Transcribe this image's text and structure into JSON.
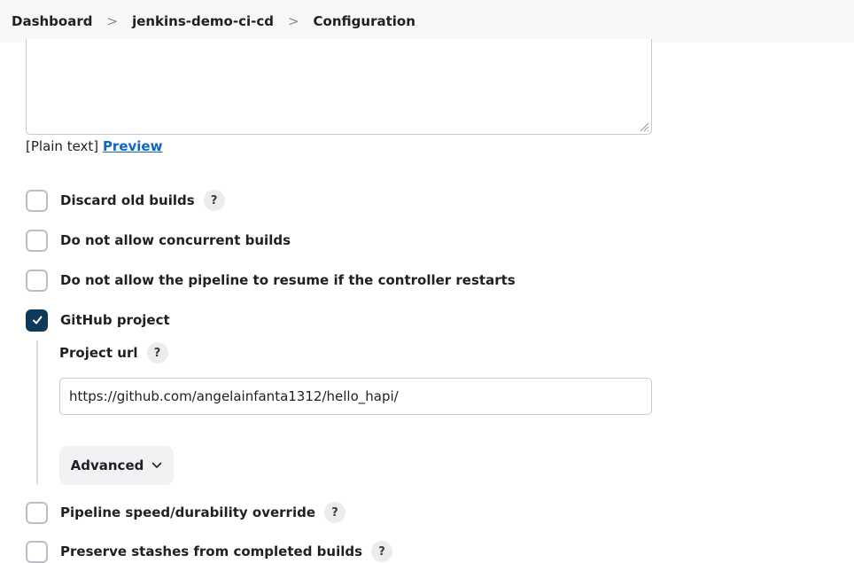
{
  "breadcrumb": {
    "items": [
      "Dashboard",
      "jenkins-demo-ci-cd",
      "Configuration"
    ],
    "separator": ">"
  },
  "description": {
    "format_text": "[Plain text]",
    "preview_link": "Preview"
  },
  "options": [
    {
      "label": "Discard old builds",
      "checked": false,
      "help": "?"
    },
    {
      "label": "Do not allow concurrent builds",
      "checked": false
    },
    {
      "label": "Do not allow the pipeline to resume if the controller restarts",
      "checked": false
    },
    {
      "label": "GitHub project",
      "checked": true
    },
    {
      "label": "Pipeline speed/durability override",
      "checked": false,
      "help": "?"
    },
    {
      "label": "Preserve stashes from completed builds",
      "checked": false,
      "help": "?"
    }
  ],
  "github_project": {
    "project_url_label": "Project url",
    "project_url_help": "?",
    "project_url_value": "https://github.com/angelainfanta1312/hello_hapi/",
    "advanced_label": "Advanced"
  },
  "colors": {
    "accent": "#0d3a5a",
    "link": "#0b67c2",
    "breadcrumb_bg": "#f7f7f8"
  },
  "icons": {
    "chevron_right": "chevron-right-icon",
    "chevron_down": "chevron-down-icon",
    "check": "check-icon",
    "resize_grip": "resize-grip-icon"
  }
}
